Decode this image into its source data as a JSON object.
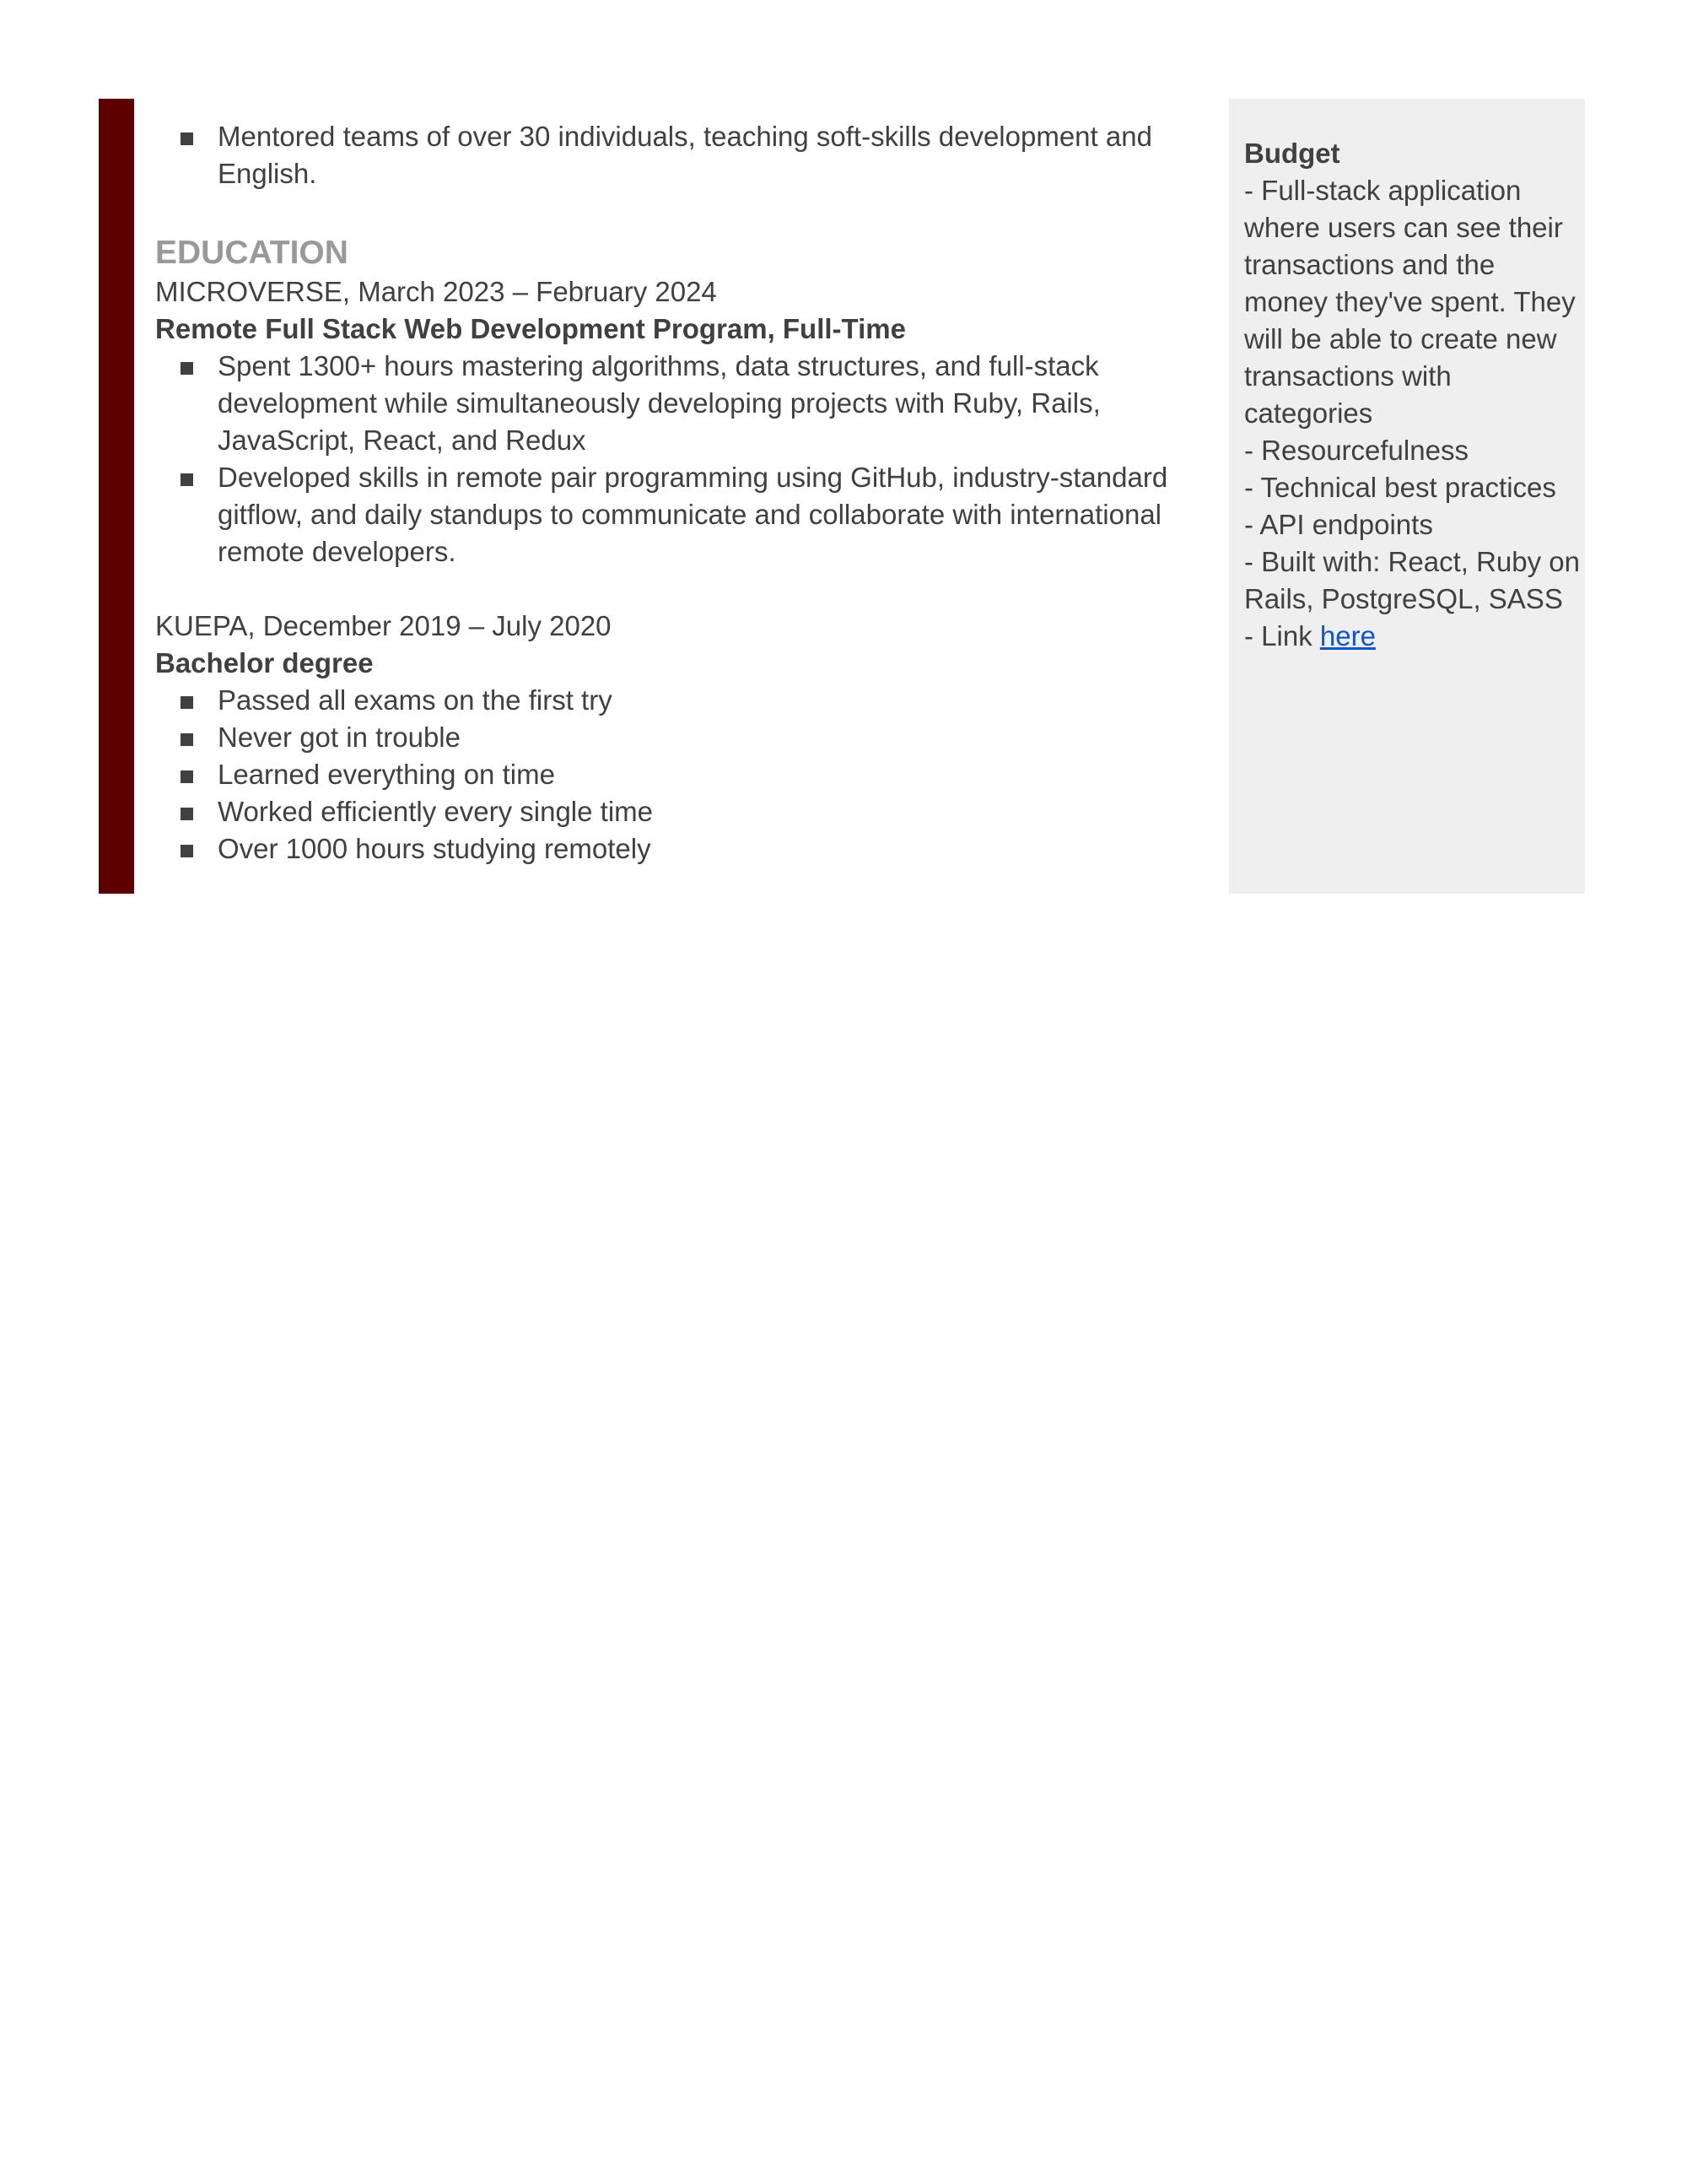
{
  "colors": {
    "accent_bar": "#5e0000",
    "heading_gray": "#999999",
    "text": "#404040",
    "sidebar_bg": "#efefef",
    "link": "#1155cc"
  },
  "intro_bullets": [
    "Mentored teams of over 30 individuals, teaching soft-skills development and English."
  ],
  "education": {
    "heading": "EDUCATION",
    "entries": [
      {
        "line": "MICROVERSE, March 2023 – February 2024",
        "title": "Remote Full Stack Web Development Program, Full-Time",
        "bullets": [
          "Spent 1300+ hours mastering algorithms, data structures, and full-stack development while simultaneously developing projects with Ruby, Rails, JavaScript, React, and Redux",
          "Developed skills in remote pair programming using GitHub, industry-standard gitflow, and daily standups to communicate and collaborate with international remote developers."
        ]
      },
      {
        "line": "KUEPA, December 2019 – July 2020",
        "title": "Bachelor degree",
        "bullets": [
          "Passed all exams on the first try",
          "Never got in trouble",
          "Learned everything on time",
          "Worked efficiently every single time",
          "Over 1000 hours studying remotely"
        ]
      }
    ]
  },
  "sidebar": {
    "title": "Budget",
    "lines": [
      "- Full-stack application where users can see their transactions and the money they've spent. They will be able to create new transactions with categories",
      "- Resourcefulness",
      "- Technical best practices",
      "- API endpoints",
      "- Built with: React, Ruby on Rails, PostgreSQL, SASS"
    ],
    "link_prefix": "- Link ",
    "link_text": "here"
  }
}
